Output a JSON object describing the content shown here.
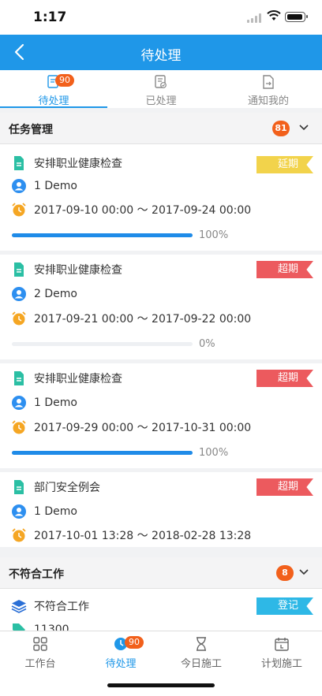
{
  "status_bar": {
    "time": "1:17"
  },
  "nav": {
    "title": "待处理"
  },
  "tabs": [
    {
      "label": "待处理",
      "badge": "90",
      "active": true
    },
    {
      "label": "已处理"
    },
    {
      "label": "通知我的"
    }
  ],
  "sections": {
    "task_mgmt": {
      "title": "任务管理",
      "count": "81"
    },
    "nonconform": {
      "title": "不符合工作",
      "count": "8"
    }
  },
  "tasks": [
    {
      "title": "安排职业健康检查",
      "assignee": "1 Demo",
      "time_range": "2017-09-10 00:00 ～ 2017-09-24 00:00",
      "tag": "延期",
      "tag_color": "#f2d34b",
      "progress": 100,
      "progress_label": "100%"
    },
    {
      "title": "安排职业健康检查",
      "assignee": "2 Demo",
      "time_range": "2017-09-21 00:00 ～ 2017-09-22 00:00",
      "tag": "超期",
      "tag_color": "#ec5a5e",
      "progress": 0,
      "progress_label": "0%"
    },
    {
      "title": "安排职业健康检查",
      "assignee": "1 Demo",
      "time_range": "2017-09-29 00:00 ～ 2017-10-31 00:00",
      "tag": "超期",
      "tag_color": "#ec5a5e",
      "progress": 100,
      "progress_label": "100%"
    },
    {
      "title": "部门安全例会",
      "assignee": "1 Demo",
      "time_range": "2017-10-01 13:28 ～ 2018-02-28 13:28",
      "tag": "超期",
      "tag_color": "#ec5a5e"
    }
  ],
  "nonconform_item": {
    "title": "不符合工作",
    "tag": "登记",
    "tag_color": "#2eb8e6",
    "code": "11300"
  },
  "bottom_tabs": [
    {
      "label": "工作台",
      "icon": "grid-icon"
    },
    {
      "label": "待处理",
      "icon": "clock-icon",
      "badge": "90",
      "active": true
    },
    {
      "label": "今日施工",
      "icon": "hourglass-icon"
    },
    {
      "label": "计划施工",
      "icon": "calendar-icon"
    }
  ],
  "colors": {
    "primary": "#1f97e8",
    "badge": "#f2601b",
    "overdue": "#ec5a5e",
    "delayed": "#f2d34b",
    "register": "#2eb8e6",
    "doc_icon": "#2bbfa4",
    "user_icon": "#2d8ff0",
    "alarm_icon": "#f5a623"
  }
}
